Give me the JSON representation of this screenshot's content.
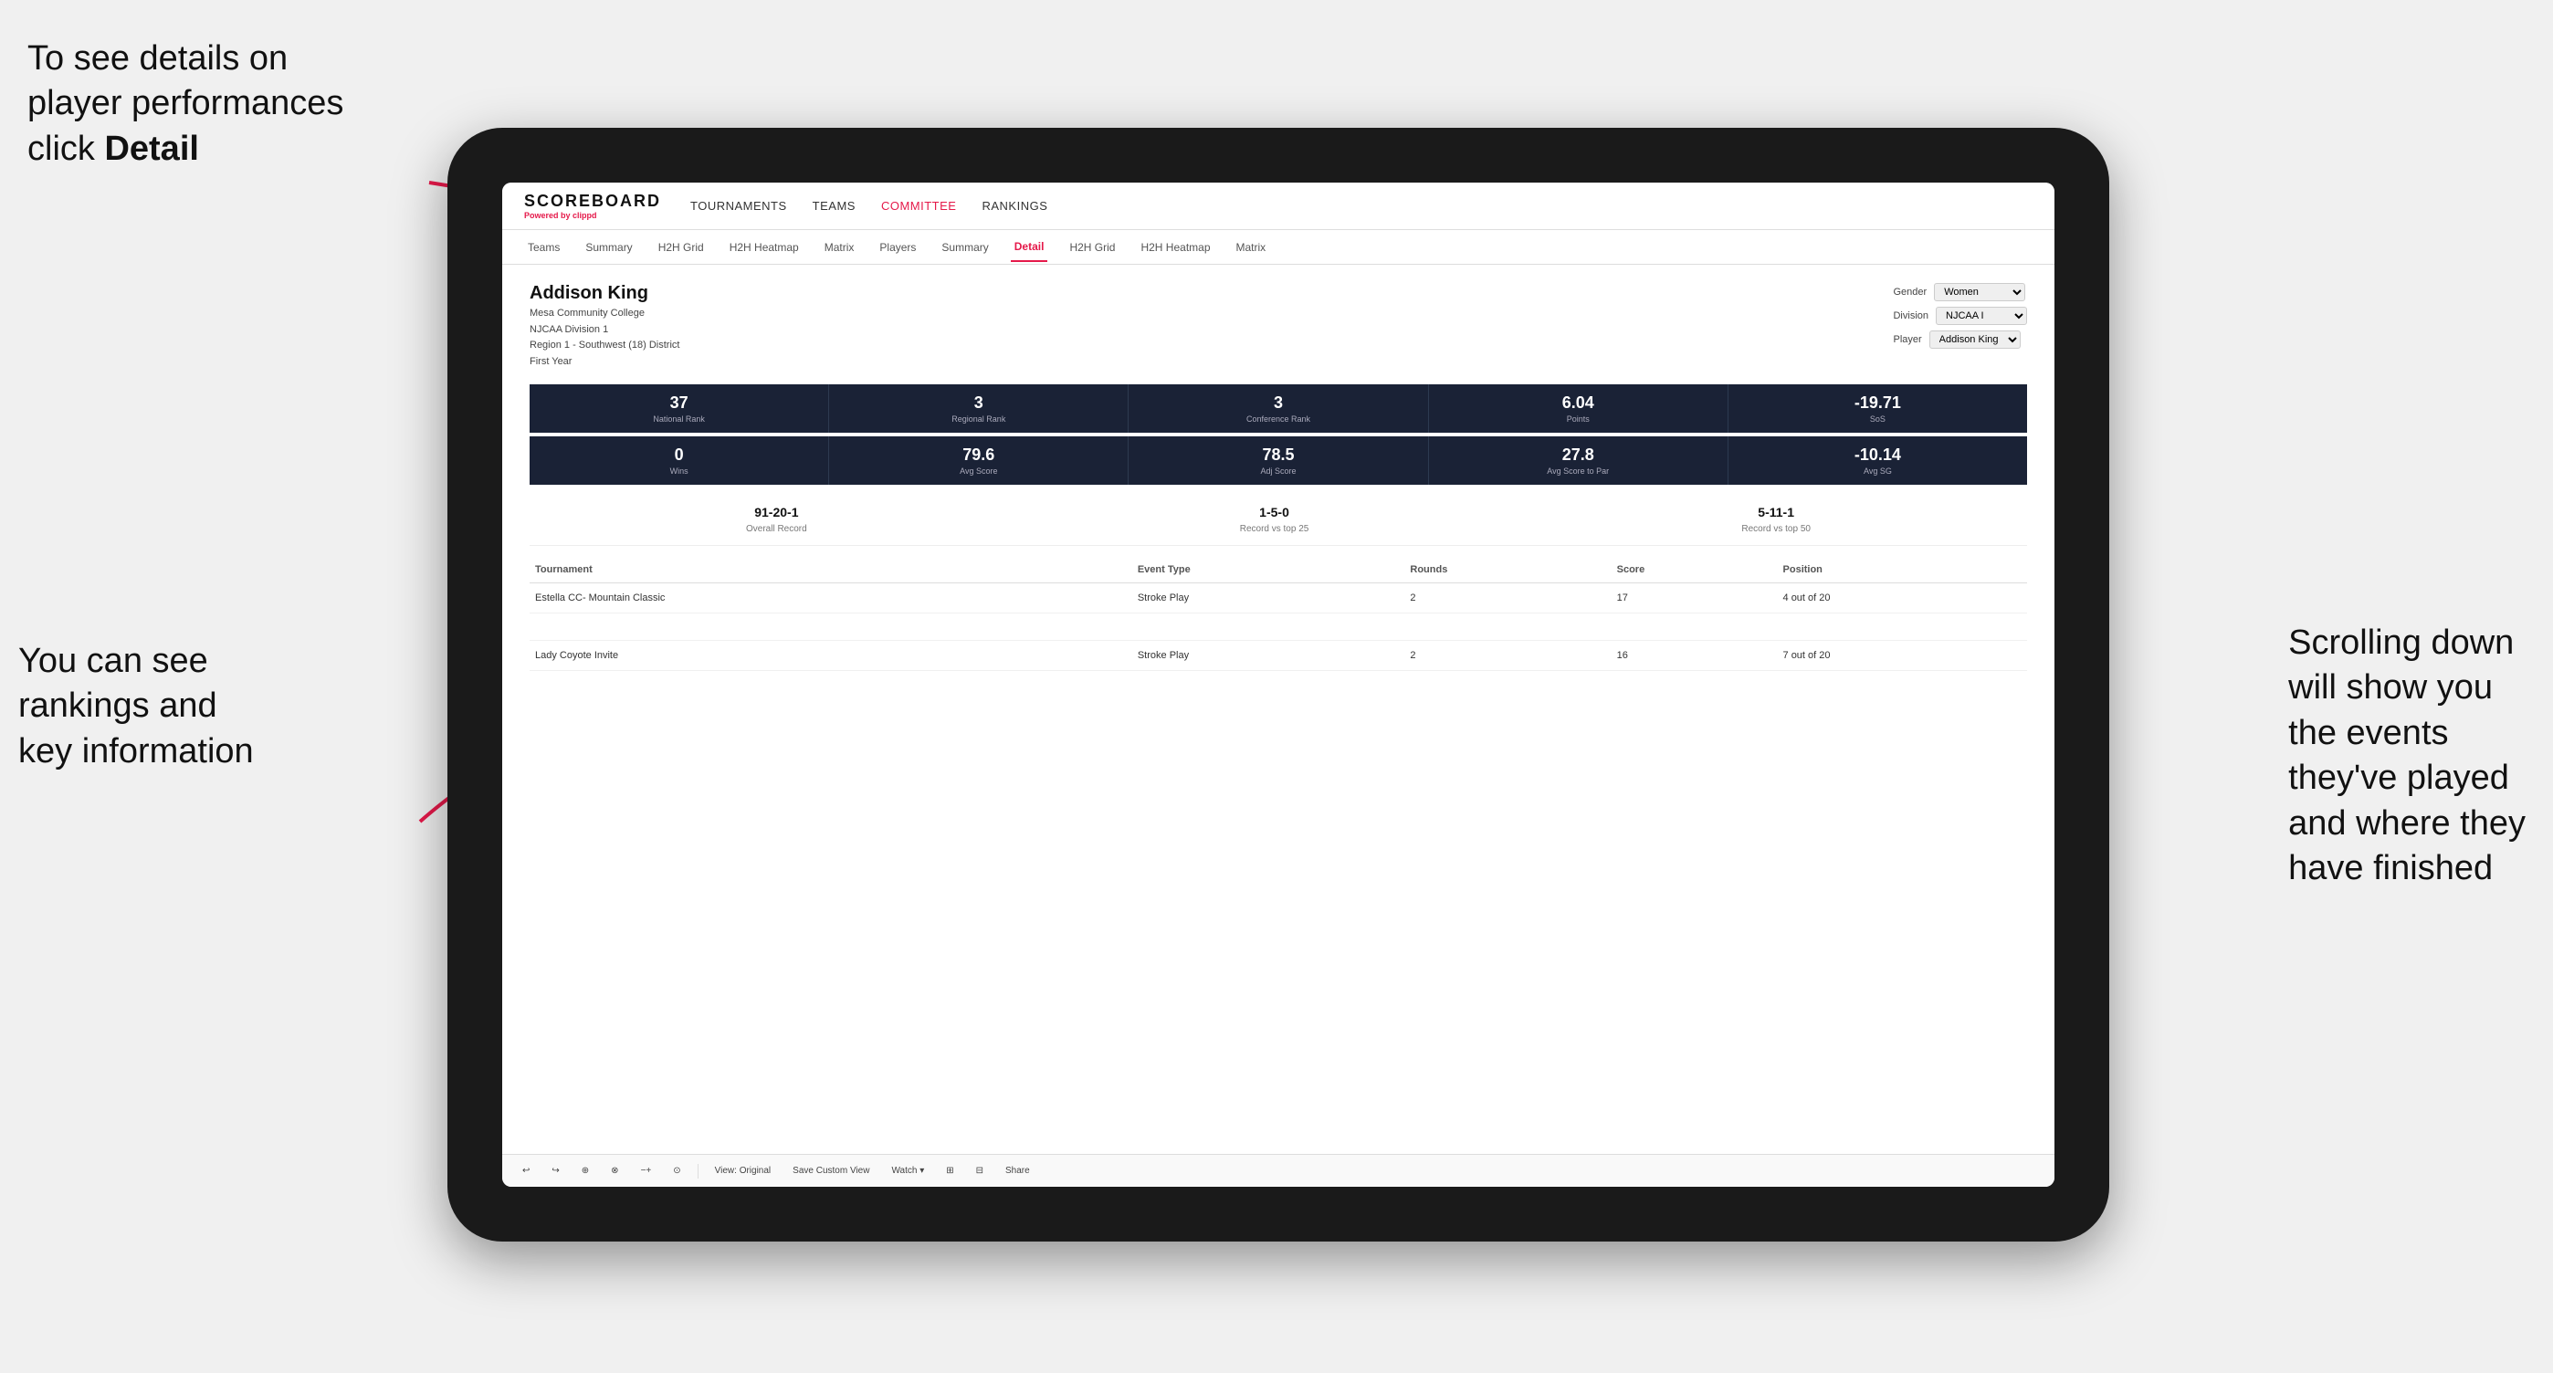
{
  "annotations": {
    "top_left": {
      "line1": "To see details on",
      "line2": "player performances",
      "line3_pre": "click ",
      "line3_bold": "Detail"
    },
    "bottom_left": {
      "line1": "You can see",
      "line2": "rankings and",
      "line3": "key information"
    },
    "bottom_right": {
      "line1": "Scrolling down",
      "line2": "will show you",
      "line3": "the events",
      "line4": "they've played",
      "line5": "and where they",
      "line6": "have finished"
    }
  },
  "nav": {
    "logo": "SCOREBOARD",
    "powered_by": "Powered by ",
    "brand": "clippd",
    "items": [
      "TOURNAMENTS",
      "TEAMS",
      "COMMITTEE",
      "RANKINGS"
    ]
  },
  "sub_nav": {
    "items": [
      "Teams",
      "Summary",
      "H2H Grid",
      "H2H Heatmap",
      "Matrix",
      "Players",
      "Summary",
      "Detail",
      "H2H Grid",
      "H2H Heatmap",
      "Matrix"
    ],
    "active": "Detail"
  },
  "player": {
    "name": "Addison King",
    "college": "Mesa Community College",
    "division": "NJCAA Division 1",
    "region": "Region 1 - Southwest (18) District",
    "year": "First Year"
  },
  "filters": {
    "gender_label": "Gender",
    "gender_value": "Women",
    "division_label": "Division",
    "division_value": "NJCAA I",
    "player_label": "Player",
    "player_value": "Addison King"
  },
  "stats_row1": [
    {
      "value": "37",
      "label": "National Rank"
    },
    {
      "value": "3",
      "label": "Regional Rank"
    },
    {
      "value": "3",
      "label": "Conference Rank"
    },
    {
      "value": "6.04",
      "label": "Points"
    },
    {
      "value": "-19.71",
      "label": "SoS"
    }
  ],
  "stats_row2": [
    {
      "value": "0",
      "label": "Wins"
    },
    {
      "value": "79.6",
      "label": "Avg Score"
    },
    {
      "value": "78.5",
      "label": "Adj Score"
    },
    {
      "value": "27.8",
      "label": "Avg Score to Par"
    },
    {
      "value": "-10.14",
      "label": "Avg SG"
    }
  ],
  "records": [
    {
      "value": "91-20-1",
      "label": "Overall Record"
    },
    {
      "value": "1-5-0",
      "label": "Record vs top 25"
    },
    {
      "value": "5-11-1",
      "label": "Record vs top 50"
    }
  ],
  "table": {
    "headers": [
      "Tournament",
      "Event Type",
      "Rounds",
      "Score",
      "Position"
    ],
    "rows": [
      {
        "tournament": "Estella CC- Mountain Classic",
        "event_type": "Stroke Play",
        "rounds": "2",
        "score": "17",
        "position": "4 out of 20"
      },
      {
        "tournament": "",
        "event_type": "",
        "rounds": "",
        "score": "",
        "position": ""
      },
      {
        "tournament": "Lady Coyote Invite",
        "event_type": "Stroke Play",
        "rounds": "2",
        "score": "16",
        "position": "7 out of 20"
      }
    ]
  },
  "toolbar": {
    "buttons": [
      "View: Original",
      "Save Custom View",
      "Watch ▾",
      "Share"
    ]
  }
}
